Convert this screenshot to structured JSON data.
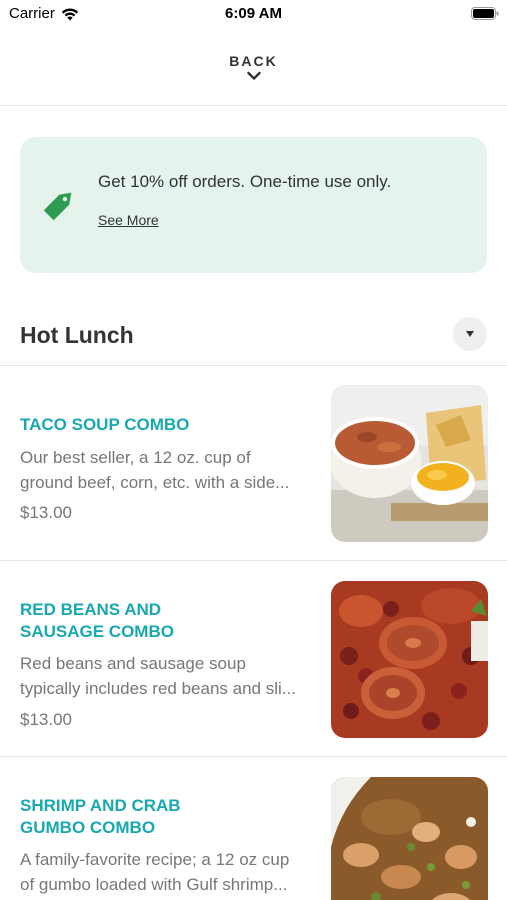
{
  "status_bar": {
    "carrier": "Carrier",
    "time": "6:09 AM"
  },
  "header": {
    "back_label": "BACK"
  },
  "promo": {
    "text": "Get 10% off orders. One-time use only.",
    "link": "See More",
    "accent_color": "#2e9b50",
    "background_color": "#e4f4ec"
  },
  "section": {
    "title": "Hot Lunch"
  },
  "colors": {
    "item_title": "#19a8b0",
    "secondary_text": "#777777"
  },
  "menu_items": [
    {
      "name": "TACO SOUP COMBO",
      "description": [
        "Our best seller, a 12 oz. cup of",
        "ground beef, corn, etc. with a side..."
      ],
      "price": "$13.00"
    },
    {
      "name": "RED BEANS  AND SAUSAGE COMBO",
      "description": [
        "Red beans and sausage soup",
        "typically includes red beans and sli..."
      ],
      "price": "$13.00"
    },
    {
      "name": "SHRIMP AND CRAB GUMBO COMBO",
      "description": [
        "A family-favorite recipe; a 12 oz cup",
        "of gumbo loaded with Gulf shrimp..."
      ],
      "price": ""
    }
  ]
}
